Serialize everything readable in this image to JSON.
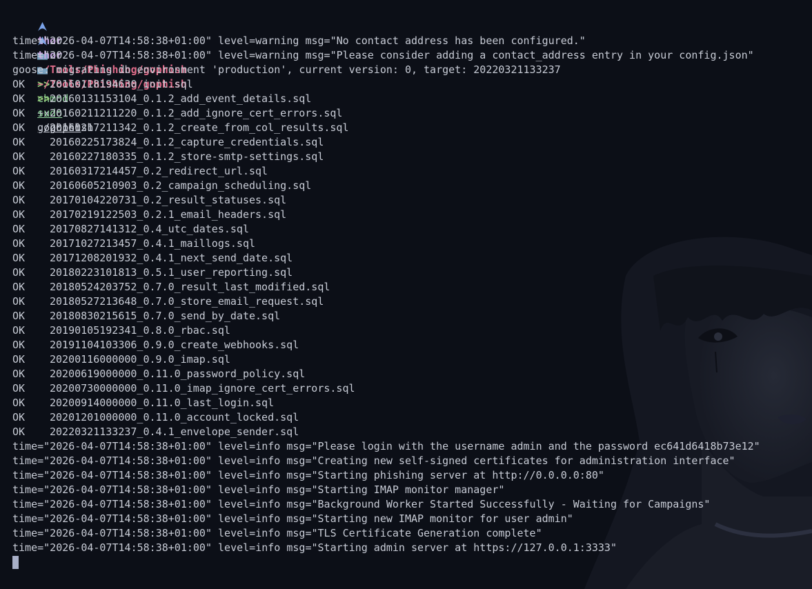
{
  "prompts": [
    {
      "user": "thor",
      "path": "~/Tools/Phishing/gophish",
      "sep": ">>",
      "cmd": "chmod",
      "args": "+x",
      "target": "gophish"
    },
    {
      "user": "thor",
      "path": "~/Tools/Phishing/gophish",
      "sep": ">>",
      "cmd": "sudo",
      "args": "./gophish",
      "target": ""
    }
  ],
  "warnings": [
    "time=\"2026-04-07T14:58:38+01:00\" level=warning msg=\"No contact address has been configured.\"",
    "time=\"2026-04-07T14:58:38+01:00\" level=warning msg=\"Please consider adding a contact_address entry in your config.json\""
  ],
  "goose": "goose: migrating db environment 'production', current version: 0, target: 20220321133237",
  "ok_label": "OK",
  "migrations": [
    "20160118194630_init.sql",
    "20160131153104_0.1.2_add_event_details.sql",
    "20160211211220_0.1.2_add_ignore_cert_errors.sql",
    "20160217211342_0.1.2_create_from_col_results.sql",
    "20160225173824_0.1.2_capture_credentials.sql",
    "20160227180335_0.1.2_store-smtp-settings.sql",
    "20160317214457_0.2_redirect_url.sql",
    "20160605210903_0.2_campaign_scheduling.sql",
    "20170104220731_0.2_result_statuses.sql",
    "20170219122503_0.2.1_email_headers.sql",
    "20170827141312_0.4_utc_dates.sql",
    "20171027213457_0.4.1_maillogs.sql",
    "20171208201932_0.4.1_next_send_date.sql",
    "20180223101813_0.5.1_user_reporting.sql",
    "20180524203752_0.7.0_result_last_modified.sql",
    "20180527213648_0.7.0_store_email_request.sql",
    "20180830215615_0.7.0_send_by_date.sql",
    "20190105192341_0.8.0_rbac.sql",
    "20191104103306_0.9.0_create_webhooks.sql",
    "20200116000000_0.9.0_imap.sql",
    "20200619000000_0.11.0_password_policy.sql",
    "20200730000000_0.11.0_imap_ignore_cert_errors.sql",
    "20200914000000_0.11.0_last_login.sql",
    "20201201000000_0.11.0_account_locked.sql",
    "20220321133237_0.4.1_envelope_sender.sql"
  ],
  "info": [
    "time=\"2026-04-07T14:58:38+01:00\" level=info msg=\"Please login with the username admin and the password ec641d6418b73e12\"",
    "time=\"2026-04-07T14:58:38+01:00\" level=info msg=\"Creating new self-signed certificates for administration interface\"",
    "time=\"2026-04-07T14:58:38+01:00\" level=info msg=\"Starting phishing server at http://0.0.0.0:80\"",
    "time=\"2026-04-07T14:58:38+01:00\" level=info msg=\"Starting IMAP monitor manager\"",
    "time=\"2026-04-07T14:58:38+01:00\" level=info msg=\"Background Worker Started Successfully - Waiting for Campaigns\"",
    "time=\"2026-04-07T14:58:38+01:00\" level=info msg=\"Starting new IMAP monitor for user admin\"",
    "time=\"2026-04-07T14:58:38+01:00\" level=info msg=\"TLS Certificate Generation complete\"",
    "time=\"2026-04-07T14:58:38+01:00\" level=info msg=\"Starting admin server at https://127.0.0.1:3333\""
  ],
  "icons": {
    "os": "arch-logo-icon",
    "folder": "folder-icon"
  },
  "colors": {
    "background": "#0c0f17",
    "user": "#c6a6e0",
    "path": "#e06c8a",
    "command": "#8fd49a",
    "text": "#c8ccd6"
  }
}
